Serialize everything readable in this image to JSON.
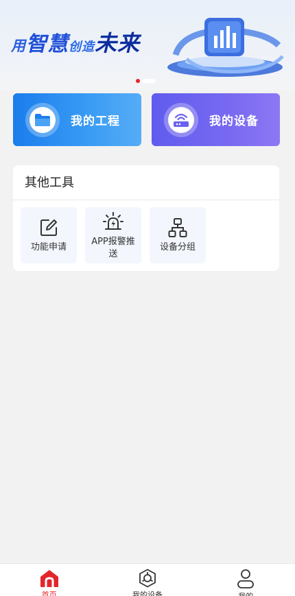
{
  "banner": {
    "slogan": {
      "part1": "用",
      "part2": "智慧",
      "part3": "创造",
      "part4": "未来"
    },
    "page_dots": {
      "total": 2,
      "active_index": 0
    }
  },
  "quick_actions": {
    "project": {
      "label": "我的工程",
      "icon": "folder-icon"
    },
    "device": {
      "label": "我的设备",
      "icon": "router-icon"
    }
  },
  "tools": {
    "title": "其他工具",
    "items": [
      {
        "label": "功能申请",
        "icon": "edit-icon"
      },
      {
        "label": "APP报警推送",
        "icon": "alarm-icon"
      },
      {
        "label": "设备分组",
        "icon": "hierarchy-icon"
      }
    ]
  },
  "nav": {
    "items": [
      {
        "label": "首页",
        "icon": "home-icon",
        "active": true
      },
      {
        "label": "我的设备",
        "icon": "device-icon",
        "active": false
      },
      {
        "label": "我的",
        "icon": "user-icon",
        "active": false
      }
    ]
  },
  "colors": {
    "accent_red": "#e3262c",
    "project_card": "#1a7dec",
    "device_card": "#6a62f0",
    "background": "#f2f2f2"
  }
}
